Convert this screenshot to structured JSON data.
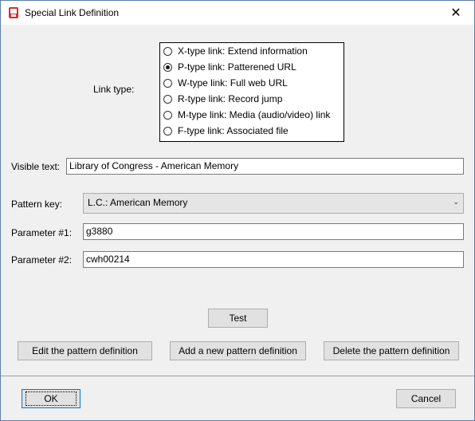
{
  "window": {
    "title": "Special Link Definition",
    "close_icon": "close-icon"
  },
  "link_type": {
    "label": "Link type:",
    "options": [
      {
        "label": "X-type link: Extend information",
        "checked": false
      },
      {
        "label": "P-type link: Patterened URL",
        "checked": true
      },
      {
        "label": "W-type link: Full web URL",
        "checked": false
      },
      {
        "label": "R-type link: Record jump",
        "checked": false
      },
      {
        "label": "M-type link: Media (audio/video) link",
        "checked": false
      },
      {
        "label": "F-type link: Associated file",
        "checked": false
      }
    ]
  },
  "visible_text": {
    "label": "Visible text:",
    "value": "Library of Congress - American Memory"
  },
  "pattern_key": {
    "label": "Pattern key:",
    "value": "L.C.: American Memory"
  },
  "parameter1": {
    "label": "Parameter #1:",
    "value": "g3880"
  },
  "parameter2": {
    "label": "Parameter #2:",
    "value": "cwh00214"
  },
  "buttons": {
    "test": "Test",
    "edit_pattern": "Edit the pattern definition",
    "add_pattern": "Add a new pattern definition",
    "delete_pattern": "Delete the pattern definition",
    "ok": "OK",
    "cancel": "Cancel"
  },
  "colors": {
    "focus_border": "#0078d7",
    "button_bg": "#e1e1e1",
    "dialog_bg": "#f0f0f0"
  }
}
